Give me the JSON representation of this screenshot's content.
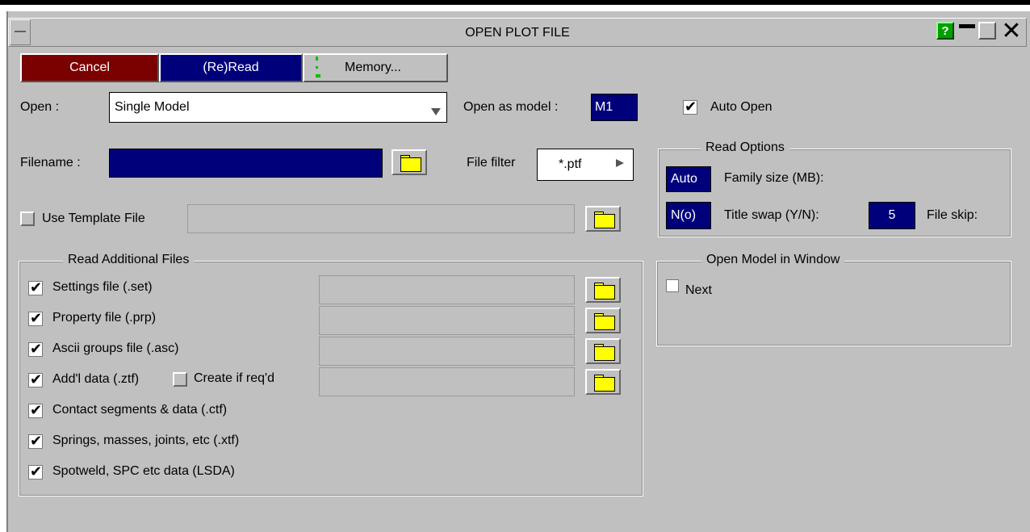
{
  "window": {
    "title": "OPEN PLOT FILE",
    "help_label": "?"
  },
  "toolbar": {
    "cancel_label": "Cancel",
    "reread_label": "(Re)Read",
    "memory_label": "Memory..."
  },
  "open": {
    "label": "Open :",
    "value": "Single Model",
    "open_as_label": "Open as model :",
    "open_as_value": "M1",
    "auto_open_label": "Auto Open",
    "auto_open_checked": true
  },
  "filename": {
    "label": "Filename :",
    "value": "",
    "filter_label": "File filter",
    "filter_value": "*.ptf"
  },
  "template": {
    "label": "Use Template File",
    "checked": false,
    "value": ""
  },
  "read_options": {
    "title": "Read Options",
    "family_value": "Auto",
    "family_label": "Family size (MB):",
    "swap_value": "N(o)",
    "swap_label": "Title swap (Y/N):",
    "skip_value": "5",
    "skip_label": "File skip:"
  },
  "additional": {
    "title": "Read Additional Files",
    "items": [
      {
        "label": "Settings file (.set)",
        "checked": true
      },
      {
        "label": "Property file (.prp)",
        "checked": true
      },
      {
        "label": "Ascii groups file (.asc)",
        "checked": true
      },
      {
        "label": "Add'l data (.ztf)",
        "checked": true
      },
      {
        "label": "Contact segments & data (.ctf)",
        "checked": true
      },
      {
        "label": "Springs, masses, joints, etc (.xtf)",
        "checked": true
      },
      {
        "label": "Spotweld, SPC etc data (LSDA)",
        "checked": true
      }
    ],
    "create_label": "Create if req'd",
    "create_checked": false
  },
  "window_group": {
    "title": "Open Model in Window",
    "next_label": "Next",
    "next_checked": false
  },
  "colors": {
    "cancel": "#7b0000",
    "reread": "#00007b",
    "panel": "#c0c0c0",
    "folder": "#ffff00",
    "help": "#00a000"
  }
}
